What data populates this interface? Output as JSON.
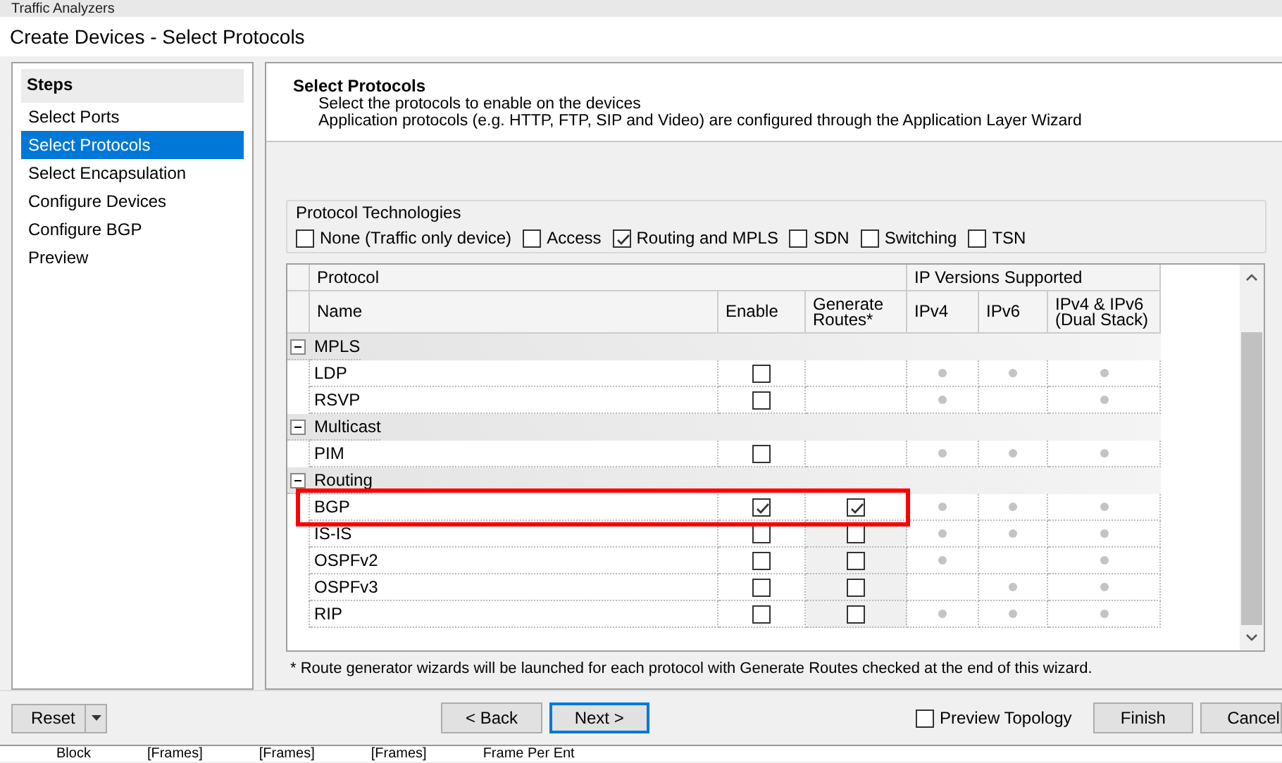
{
  "background_window": {
    "title": "Traffic Analyzers",
    "bottom_cells": [
      "Block",
      "[Frames]",
      "[Frames]",
      "[Frames]",
      "Frame Per Ent"
    ]
  },
  "window": {
    "title": "Create Devices - Select Protocols"
  },
  "steps": {
    "title": "Steps",
    "items": [
      {
        "label": "Select Ports",
        "selected": false
      },
      {
        "label": "Select Protocols",
        "selected": true
      },
      {
        "label": "Select Encapsulation",
        "selected": false
      },
      {
        "label": "Configure Devices",
        "selected": false
      },
      {
        "label": "Configure BGP",
        "selected": false
      },
      {
        "label": "Preview",
        "selected": false
      }
    ]
  },
  "header": {
    "title": "Select Protocols",
    "lines": [
      "Select the protocols to enable on the devices",
      "Application protocols (e.g. HTTP, FTP, SIP and Video) are configured through the Application Layer Wizard"
    ]
  },
  "protocol_technologies": {
    "title": "Protocol Technologies",
    "options": [
      {
        "label": "None (Traffic only device)",
        "checked": false
      },
      {
        "label": "Access",
        "checked": false
      },
      {
        "label": "Routing and MPLS",
        "checked": true
      },
      {
        "label": "SDN",
        "checked": false
      },
      {
        "label": "Switching",
        "checked": false
      },
      {
        "label": "TSN",
        "checked": false
      }
    ]
  },
  "table": {
    "group_headers": [
      "Protocol",
      "IP Versions Supported"
    ],
    "columns": [
      "Name",
      "Enable",
      "Generate Routes*",
      "IPv4",
      "IPv6",
      "IPv4 & IPv6 (Dual Stack)"
    ],
    "groups": [
      {
        "name": "MPLS",
        "expanded": true,
        "rows": [
          {
            "name": "LDP",
            "enable": false,
            "ipv4": true,
            "ipv6": true,
            "dual": true,
            "highlight": false
          },
          {
            "name": "RSVP",
            "enable": false,
            "ipv4": true,
            "ipv6": false,
            "dual": true,
            "highlight": false
          }
        ]
      },
      {
        "name": "Multicast",
        "expanded": true,
        "rows": [
          {
            "name": "PIM",
            "enable": false,
            "ipv4": true,
            "ipv6": true,
            "dual": true,
            "highlight": false
          }
        ]
      },
      {
        "name": "Routing",
        "expanded": true,
        "rows": [
          {
            "name": "BGP",
            "enable": true,
            "generate_checked": true,
            "generate_disabled": false,
            "ipv4": true,
            "ipv6": true,
            "dual": true,
            "highlight": true
          },
          {
            "name": "IS-IS",
            "enable": false,
            "generate_checked": false,
            "generate_disabled": true,
            "ipv4": true,
            "ipv6": true,
            "dual": true,
            "highlight": false
          },
          {
            "name": "OSPFv2",
            "enable": false,
            "generate_checked": false,
            "generate_disabled": true,
            "ipv4": true,
            "ipv6": false,
            "dual": true,
            "highlight": false
          },
          {
            "name": "OSPFv3",
            "enable": false,
            "generate_checked": false,
            "generate_disabled": true,
            "ipv4": false,
            "ipv6": true,
            "dual": true,
            "highlight": false
          },
          {
            "name": "RIP",
            "enable": false,
            "generate_checked": false,
            "generate_disabled": true,
            "ipv4": true,
            "ipv6": true,
            "dual": true,
            "highlight": false
          }
        ]
      }
    ]
  },
  "footnote": "* Route generator wizards will be launched for each protocol with Generate Routes checked at the end of this wizard.",
  "buttons": {
    "reset": "Reset",
    "back": "< Back",
    "next": "Next >",
    "preview_topology": {
      "label": "Preview Topology",
      "checked": false
    },
    "finish": "Finish",
    "cancel": "Cancel"
  }
}
